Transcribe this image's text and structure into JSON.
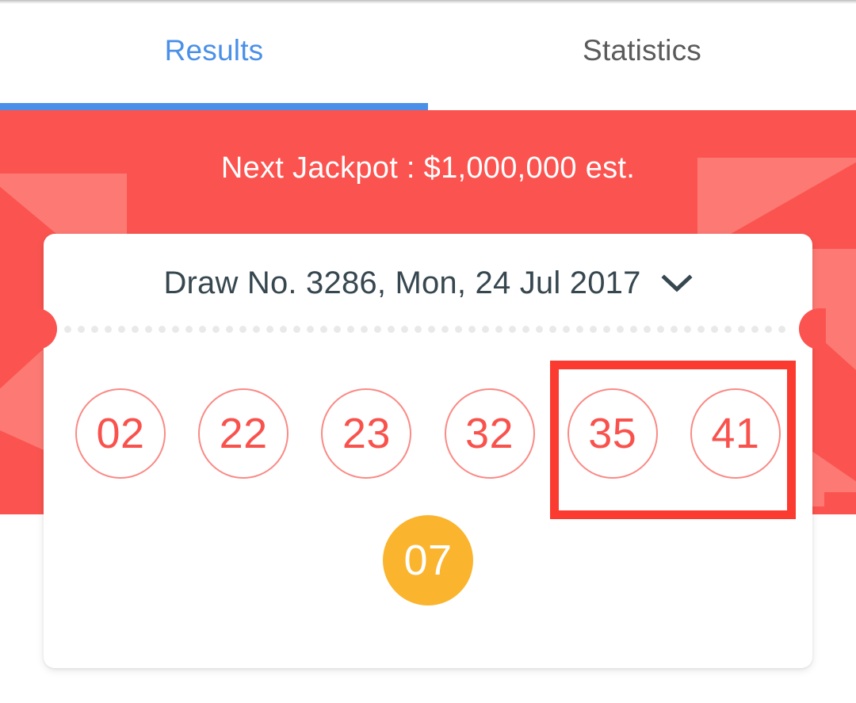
{
  "app": {
    "top_bar_color": "#fb5450",
    "accent_color": "#4a90e8",
    "supplementary_color": "#fbb42e",
    "highlight_color": "#fb3b30"
  },
  "tabs": [
    {
      "label": "Results",
      "active": true
    },
    {
      "label": "Statistics",
      "active": false
    }
  ],
  "hero": {
    "jackpot_text": "Next Jackpot : $1,000,000 est."
  },
  "ticket": {
    "draw_label": "Draw No. 3286, Mon, 24 Jul 2017",
    "dropdown_icon": "chevron-down-icon",
    "main_numbers": [
      "02",
      "22",
      "23",
      "32",
      "35",
      "41"
    ],
    "supplementary_number": "07",
    "highlighted_numbers": [
      "35",
      "41"
    ]
  }
}
